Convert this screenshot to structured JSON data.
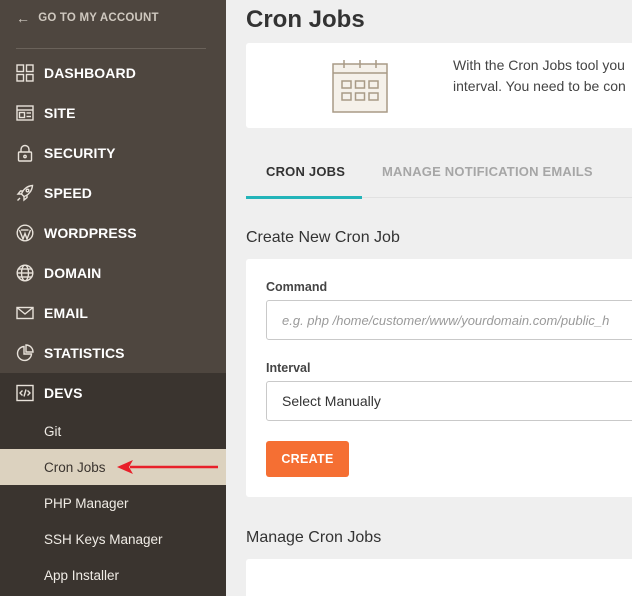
{
  "sidebar": {
    "back_label": "GO TO MY ACCOUNT",
    "items": [
      {
        "label": "DASHBOARD",
        "icon": "dashboard-icon"
      },
      {
        "label": "SITE",
        "icon": "site-icon"
      },
      {
        "label": "SECURITY",
        "icon": "lock-icon"
      },
      {
        "label": "SPEED",
        "icon": "rocket-icon"
      },
      {
        "label": "WORDPRESS",
        "icon": "wordpress-icon"
      },
      {
        "label": "DOMAIN",
        "icon": "globe-icon"
      },
      {
        "label": "EMAIL",
        "icon": "envelope-icon"
      },
      {
        "label": "STATISTICS",
        "icon": "pie-chart-icon"
      },
      {
        "label": "DEVS",
        "icon": "code-icon"
      }
    ],
    "sub_items": [
      {
        "label": "Git"
      },
      {
        "label": "Cron Jobs",
        "active": true
      },
      {
        "label": "PHP Manager"
      },
      {
        "label": "SSH Keys Manager"
      },
      {
        "label": "App Installer"
      }
    ]
  },
  "main": {
    "title": "Cron Jobs",
    "info_line1": "With the Cron Jobs tool you",
    "info_line2": "interval. You need to be con",
    "tabs": [
      {
        "label": "CRON JOBS",
        "active": true
      },
      {
        "label": "MANAGE NOTIFICATION EMAILS",
        "active": false
      }
    ],
    "create_section_title": "Create New Cron Job",
    "command_label": "Command",
    "command_placeholder": "e.g. php /home/customer/www/yourdomain.com/public_h",
    "interval_label": "Interval",
    "interval_value": "Select Manually",
    "create_button": "CREATE",
    "manage_section_title": "Manage Cron Jobs"
  },
  "colors": {
    "sidebar_bg": "#4e463f",
    "sidebar_dark": "#3a342f",
    "active_sub_bg": "#dcd2bf",
    "accent_teal": "#23b4b9",
    "button_orange": "#f56f33",
    "annotation_red": "#e8202a"
  }
}
